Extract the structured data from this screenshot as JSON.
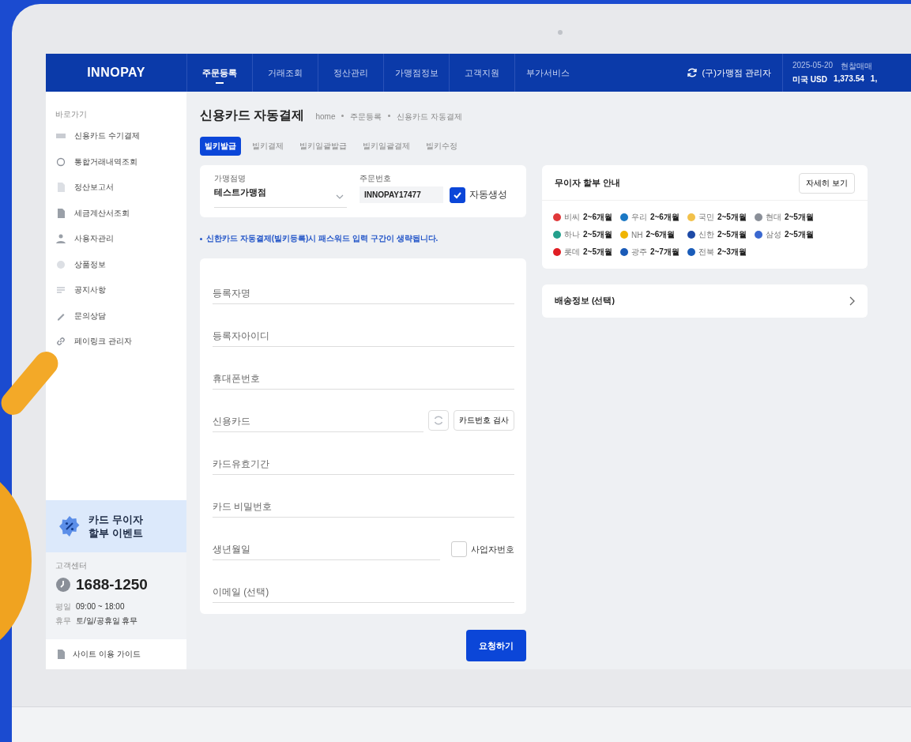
{
  "header": {
    "logo": "INNOPAY",
    "nav": [
      {
        "label": "주문등록",
        "selected": true
      },
      {
        "label": "거래조회",
        "selected": false
      },
      {
        "label": "정산관리",
        "selected": false
      },
      {
        "label": "가맹점정보",
        "selected": false
      },
      {
        "label": "고객지원",
        "selected": false
      },
      {
        "label": "부가서비스",
        "selected": false
      }
    ],
    "account": "(구)가맹점 관리자",
    "rate": {
      "date": "2025-05-20",
      "type": "현찰매매",
      "currency": "미국 USD",
      "value": "1,373.54",
      "cut": "1,"
    }
  },
  "sidebar": {
    "heading": "바로가기",
    "items": [
      {
        "label": "신용카드 수기결제"
      },
      {
        "label": "통합거래내역조회"
      },
      {
        "label": "정산보고서"
      },
      {
        "label": "세금계산서조회"
      },
      {
        "label": "사용자관리"
      },
      {
        "label": "상품정보"
      },
      {
        "label": "공지사항"
      },
      {
        "label": "문의상담"
      },
      {
        "label": "페이링크 관리자"
      }
    ],
    "promo": [
      "카드 무이자",
      "할부 이벤트"
    ],
    "support": {
      "heading": "고객센터",
      "phone": "1688-1250",
      "hours": [
        {
          "label": "평일",
          "value": "09:00 ~ 18:00"
        },
        {
          "label": "휴무",
          "value": "토/일/공휴일 휴무"
        }
      ]
    },
    "guide": "사이트 이용 가이드"
  },
  "page": {
    "title": "신용카드 자동결제",
    "breadcrumb": [
      "home",
      "주문등록",
      "신용카드 자동결제"
    ],
    "tabs": [
      {
        "label": "빌키발급",
        "selected": true
      },
      {
        "label": "빌키결제",
        "selected": false
      },
      {
        "label": "빌키일괄발급",
        "selected": false
      },
      {
        "label": "빌키일괄결제",
        "selected": false
      },
      {
        "label": "빌키수정",
        "selected": false
      }
    ]
  },
  "merchant": {
    "label": "가맹점명",
    "value": "테스트가맹점"
  },
  "order": {
    "label": "주문번호",
    "value": "INNOPAY17477",
    "auto": {
      "label": "자동생성",
      "checked": true
    }
  },
  "notice": "신한카드 자동결제(빌키등록)시 패스워드 입력 구간이 생략됩니다.",
  "fields": [
    {
      "kind": "text",
      "placeholder": "등록자명"
    },
    {
      "kind": "text",
      "placeholder": "등록자아이디"
    },
    {
      "kind": "text",
      "placeholder": "휴대폰번호"
    },
    {
      "kind": "card",
      "placeholder": "신용카드",
      "button": "카드번호 검사"
    },
    {
      "kind": "text",
      "placeholder": "카드유효기간"
    },
    {
      "kind": "text",
      "placeholder": "카드 비밀번호"
    },
    {
      "kind": "birth",
      "placeholder": "생년월일",
      "check": {
        "label": "사업자번호",
        "checked": false
      }
    },
    {
      "kind": "text",
      "placeholder": "이메일 (선택)"
    }
  ],
  "submit": "요청하기",
  "installment": {
    "title": "무이자 할부 안내",
    "more": "자세히 보기",
    "banks": [
      {
        "name": "비씨",
        "term": "2~6개월",
        "color": "#e0383a"
      },
      {
        "name": "우리",
        "term": "2~6개월",
        "color": "#1b78c4"
      },
      {
        "name": "국민",
        "term": "2~5개월",
        "color": "#f2c14a"
      },
      {
        "name": "현대",
        "term": "2~5개월",
        "color": "#8a8f98"
      },
      {
        "name": "하나",
        "term": "2~5개월",
        "color": "#24a08c"
      },
      {
        "name": "NH",
        "term": "2~6개월",
        "color": "#f0b400"
      },
      {
        "name": "신한",
        "term": "2~5개월",
        "color": "#1d4aa6"
      },
      {
        "name": "삼성",
        "term": "2~5개월",
        "color": "#3a68d0"
      },
      {
        "name": "롯데",
        "term": "2~5개월",
        "color": "#e01e24"
      },
      {
        "name": "광주",
        "term": "2~7개월",
        "color": "#1a5bb8"
      },
      {
        "name": "전북",
        "term": "2~3개월",
        "color": "#1a5cb9"
      }
    ]
  },
  "shipping": {
    "label": "배송정보 (선택)"
  }
}
